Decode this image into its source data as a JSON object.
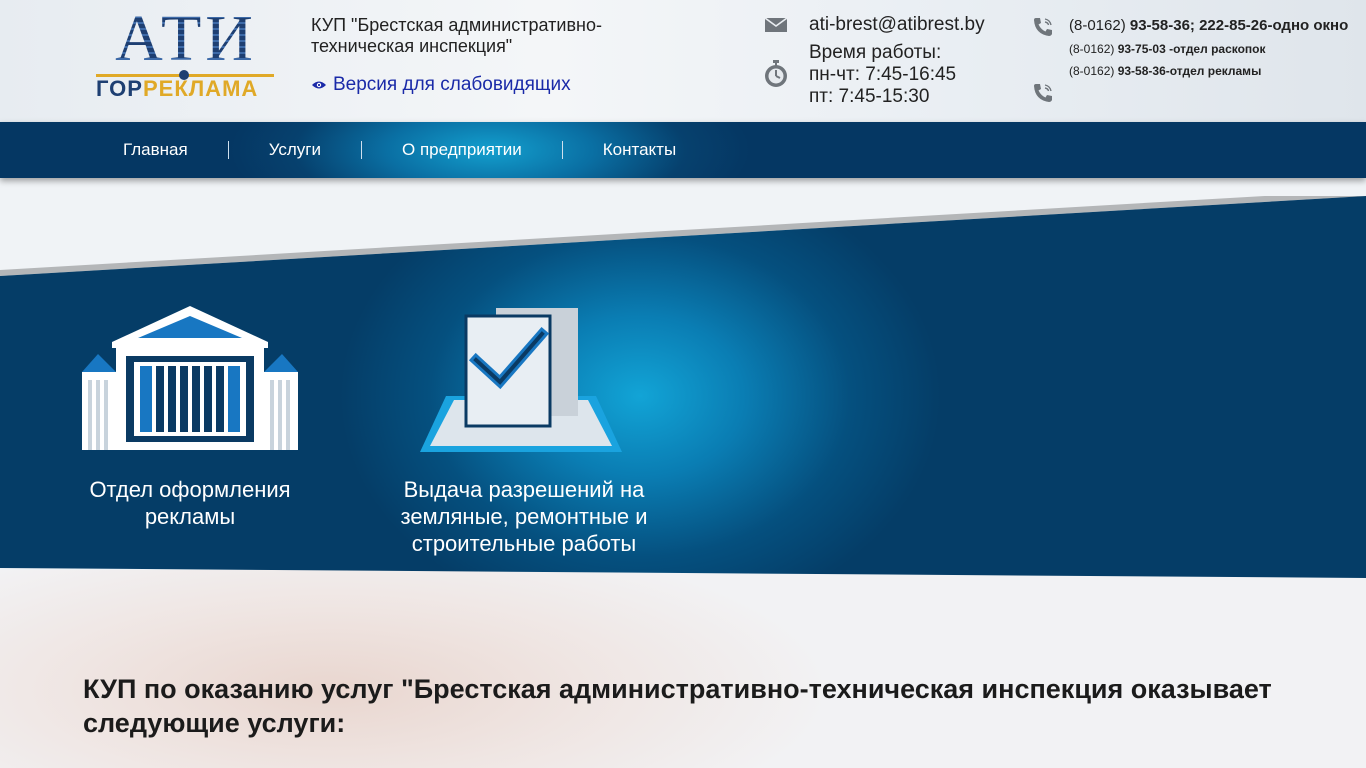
{
  "logo": {
    "big": "АТИ",
    "small_a": "ГОР",
    "small_b": "РЕКЛАМА"
  },
  "header": {
    "org_name": "КУП \"Брестская административно-техническая инспекция\"",
    "vision_link": "Версия для слабовидящих",
    "email": "ati-brest@atibrest.by",
    "hours_label": "Время работы:",
    "hours_1": "пн-чт: 7:45-16:45",
    "hours_2": "пт: 7:45-15:30",
    "phone_1_code": "(8-0162)",
    "phone_1_number": "93-58-36; 222-85-26-одно окно",
    "phone_2_code": "(8-0162)",
    "phone_2_number": "93-75-03 -отдел раскопок",
    "phone_3_code": "(8-0162)",
    "phone_3_number": "93-58-36-отдел рекламы"
  },
  "nav": {
    "items": [
      "Главная",
      "Услуги",
      "О предприятии",
      "Контакты"
    ]
  },
  "services": [
    {
      "title": "Отдел оформления рекламы",
      "icon": "building-icon"
    },
    {
      "title": "Выдача разрешений на земляные, ремонтные и строительные работы",
      "icon": "document-check-icon"
    }
  ],
  "main": {
    "heading": "КУП по оказанию услуг \"Брестская административно-техническая инспекция оказывает следующие услуги:"
  },
  "colors": {
    "nav_dark": "#053763",
    "nav_accent": "#139fce",
    "link": "#1a2aa8",
    "logo_blue": "#1e3f72",
    "logo_gold": "#e0a927"
  }
}
